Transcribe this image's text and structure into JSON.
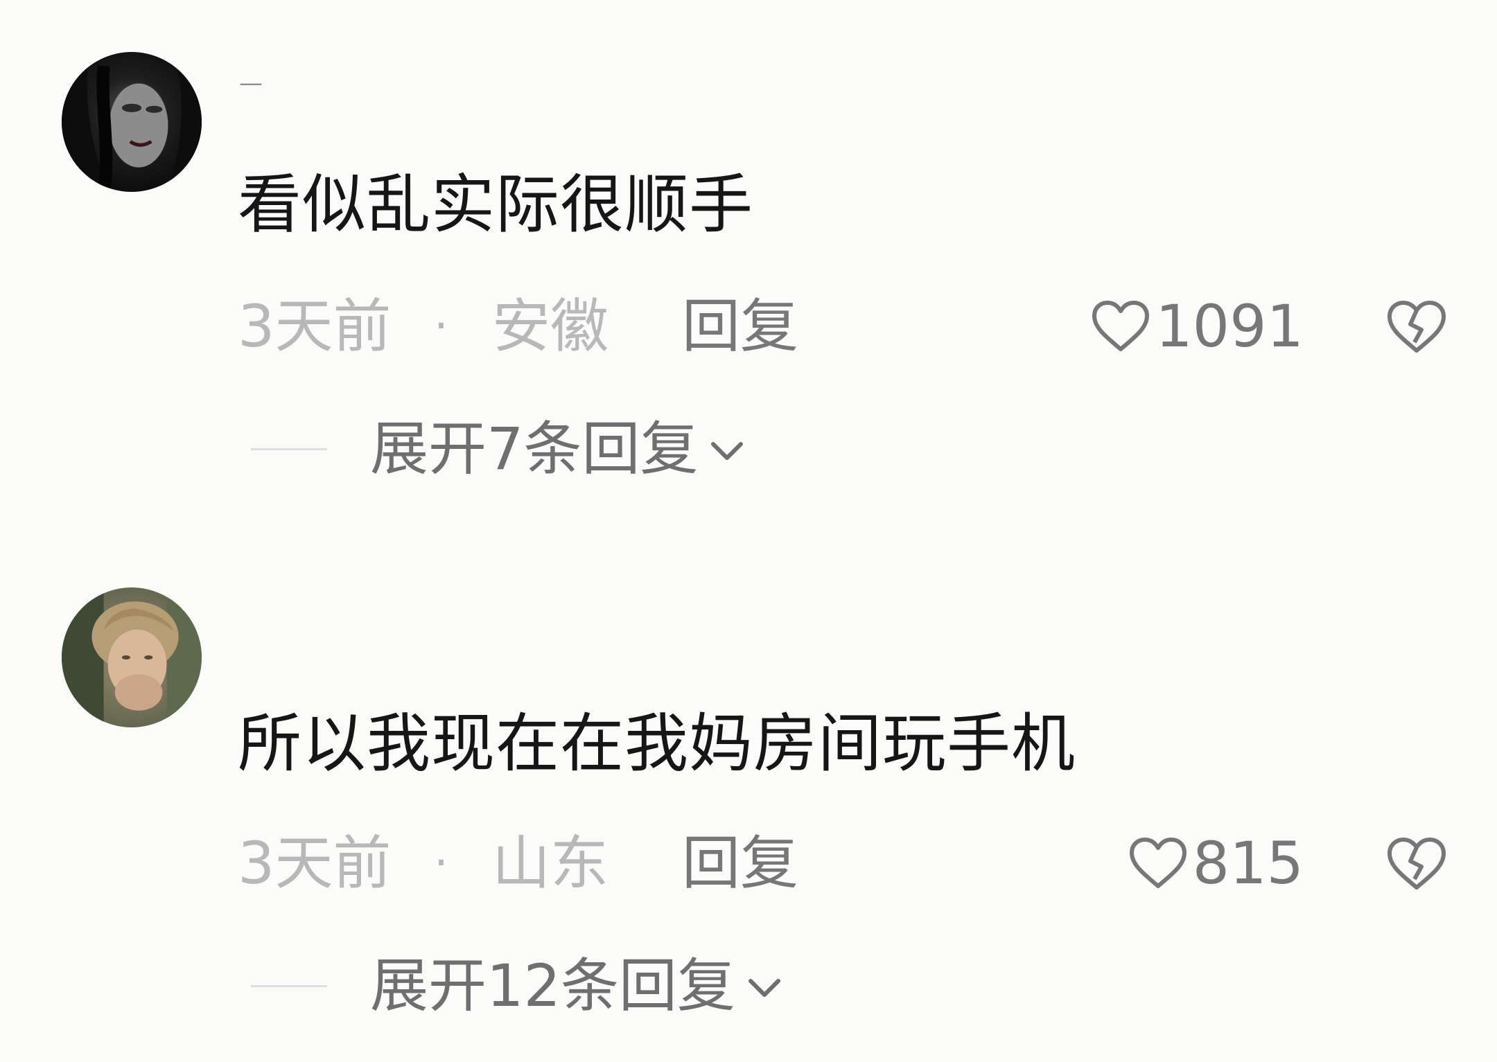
{
  "comments": [
    {
      "username": "—",
      "content": "看似乱实际很顺手",
      "time": "3天前",
      "separator": "·",
      "location": "安徽",
      "reply_label": "回复",
      "likes": "1091",
      "expand_label": "展开7条回复",
      "avatar_icon": "dark-portrait-avatar"
    },
    {
      "username": "",
      "content": "所以我现在在我妈房间玩手机",
      "time": "3天前",
      "separator": "·",
      "location": "山东",
      "reply_label": "回复",
      "likes": "815",
      "expand_label": "展开12条回复",
      "avatar_icon": "photo-portrait-avatar"
    }
  ],
  "icons": {
    "like": "heart-outline-icon",
    "dislike": "broken-heart-icon",
    "expand": "chevron-down-icon"
  },
  "colors": {
    "background": "#fbfbf9",
    "content_text": "#161616",
    "meta_text": "#b8b8b8",
    "action_text": "#777777"
  }
}
